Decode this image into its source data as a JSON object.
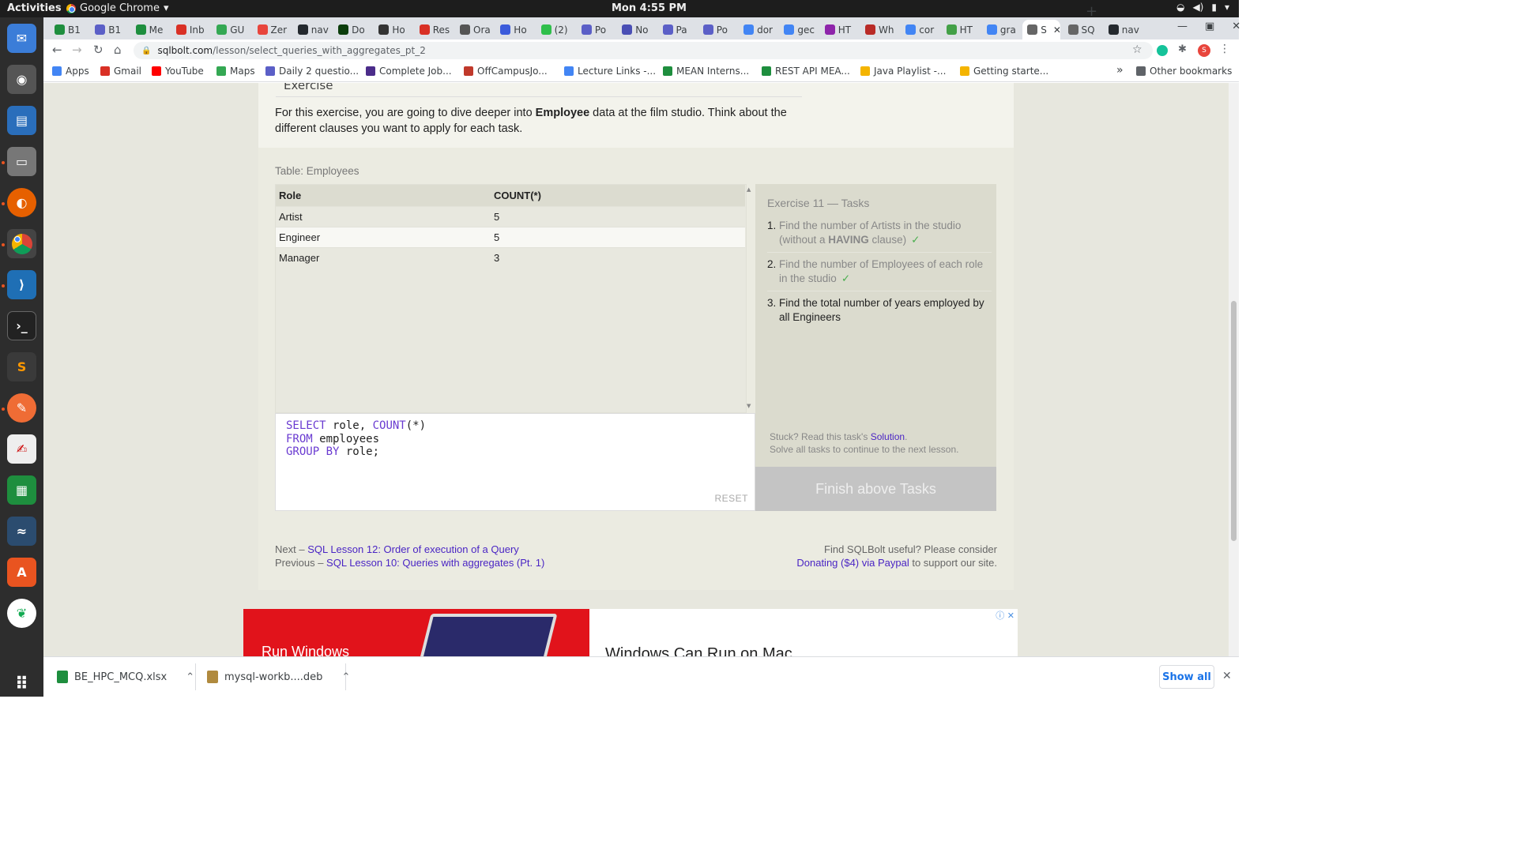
{
  "system": {
    "activities": "Activities",
    "app_name": "Google Chrome",
    "clock": "Mon  4:55 PM"
  },
  "tabs": [
    {
      "label": "B1",
      "color": "#1e8e3e"
    },
    {
      "label": "B1",
      "color": "#5b5fc7"
    },
    {
      "label": "Me",
      "color": "#1e8e3e"
    },
    {
      "label": "Inb",
      "color": "#d93025"
    },
    {
      "label": "GU",
      "color": "#34a853"
    },
    {
      "label": "Zer",
      "color": "#e8453c"
    },
    {
      "label": "nav",
      "color": "#24292e"
    },
    {
      "label": "Do",
      "color": "#0b3d0b"
    },
    {
      "label": "Ho",
      "color": "#333333"
    },
    {
      "label": "Res",
      "color": "#d93025"
    },
    {
      "label": "Ora",
      "color": "#555555"
    },
    {
      "label": "Ho",
      "color": "#3b5bdb"
    },
    {
      "label": "(2)",
      "color": "#2fbf4b"
    },
    {
      "label": "Po",
      "color": "#5b5fc7"
    },
    {
      "label": "No",
      "color": "#4a4fb5"
    },
    {
      "label": "Pa",
      "color": "#5b5fc7"
    },
    {
      "label": "Po",
      "color": "#5b5fc7"
    },
    {
      "label": "dor",
      "color": "#4285f4"
    },
    {
      "label": "gec",
      "color": "#4285f4"
    },
    {
      "label": "HT",
      "color": "#8e24aa"
    },
    {
      "label": "Wh",
      "color": "#b92b27"
    },
    {
      "label": "cor",
      "color": "#4285f4"
    },
    {
      "label": "HT",
      "color": "#43a047"
    },
    {
      "label": "gra",
      "color": "#4285f4"
    },
    {
      "label": "S",
      "color": "#666666",
      "active": true
    },
    {
      "label": "SQ",
      "color": "#666666"
    },
    {
      "label": "nav",
      "color": "#24292e"
    }
  ],
  "address": {
    "domain": "sqlbolt.com",
    "path": "/lesson/select_queries_with_aggregates_pt_2"
  },
  "profile_initial": "S",
  "bookmarks": [
    {
      "label": "Apps",
      "color": "#4285f4"
    },
    {
      "label": "Gmail",
      "color": "#d93025"
    },
    {
      "label": "YouTube",
      "color": "#ff0000"
    },
    {
      "label": "Maps",
      "color": "#34a853"
    },
    {
      "label": "Daily 2 questio...",
      "color": "#5b5fc7"
    },
    {
      "label": "Complete Job...",
      "color": "#4b2c8a"
    },
    {
      "label": "OffCampusJo...",
      "color": "#c0392b"
    },
    {
      "label": "Lecture Links -...",
      "color": "#4285f4"
    },
    {
      "label": "MEAN Interns...",
      "color": "#1e8e3e"
    },
    {
      "label": "REST API MEA...",
      "color": "#1e8e3e"
    },
    {
      "label": "Java Playlist -...",
      "color": "#f4b400"
    },
    {
      "label": "Getting starte...",
      "color": "#f4b400"
    }
  ],
  "bookmarks_overflow": "»",
  "other_bookmarks": "Other bookmarks",
  "page": {
    "exercise_heading": "Exercise",
    "intro_before": "For this exercise, you are going to dive deeper into ",
    "intro_bold": "Employee",
    "intro_after": " data at the film studio. Think about the different clauses you want to apply for each task.",
    "table_caption": "Table: Employees",
    "result_table": {
      "headers": [
        "Role",
        "COUNT(*)"
      ],
      "rows": [
        [
          "Artist",
          "5"
        ],
        [
          "Engineer",
          "5"
        ],
        [
          "Manager",
          "3"
        ]
      ]
    },
    "editor": {
      "line1_kw": "SELECT",
      "line1_rest": " role, ",
      "line1_fn": "COUNT",
      "line1_end": "(*)",
      "line2_kw": "FROM",
      "line2_rest": " employees",
      "line3_kw": "GROUP BY",
      "line3_rest": " role;",
      "reset_label": "RESET"
    },
    "tasks": {
      "title": "Exercise 11 — Tasks",
      "items": [
        {
          "num": "1.",
          "text_before": "Find the number of Artists in the studio (without a ",
          "text_bold": "HAVING",
          "text_after": " clause)",
          "check": "✓",
          "done": true
        },
        {
          "num": "2.",
          "text_before": "Find the number of Employees of each role in the studio",
          "text_bold": "",
          "text_after": "",
          "check": "✓",
          "done": true
        },
        {
          "num": "3.",
          "text_before": "Find the total number of years employed by all Engineers",
          "text_bold": "",
          "text_after": "",
          "check": "",
          "done": false
        }
      ],
      "hint_before": "Stuck? Read this task's ",
      "hint_link": "Solution",
      "hint_after": ".",
      "hint_line2": "Solve all tasks to continue to the next lesson.",
      "finish_label": "Finish above Tasks"
    },
    "footer": {
      "next_prefix": "Next – ",
      "next_link": "SQL Lesson 12: Order of execution of a Query",
      "prev_prefix": "Previous – ",
      "prev_link": "SQL Lesson 10: Queries with aggregates (Pt. 1)",
      "donate_line1": "Find SQLBolt useful? Please consider",
      "donate_link": "Donating ($4) via Paypal",
      "donate_after": " to support our site."
    },
    "ad": {
      "left_text": "Run Windows",
      "right_text": "Windows Can Run on Mac"
    }
  },
  "downloads": {
    "items": [
      {
        "name": "BE_HPC_MCQ.xlsx",
        "color": "#1e8e3e"
      },
      {
        "name": "mysql-workb....deb",
        "color": "#b08a3e"
      }
    ],
    "show_all": "Show all"
  }
}
